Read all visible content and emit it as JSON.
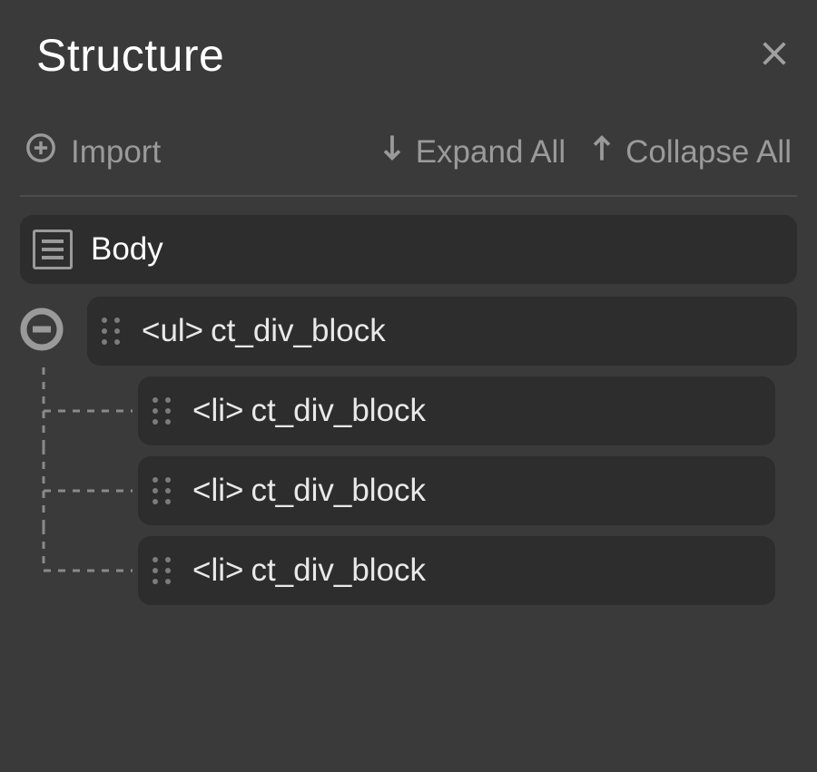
{
  "header": {
    "title": "Structure"
  },
  "toolbar": {
    "import_label": "Import",
    "expand_label": "Expand All",
    "collapse_label": "Collapse All"
  },
  "tree": {
    "body_label": "Body",
    "ul_row": {
      "tag": "<ul>",
      "name": "ct_div_block"
    },
    "children": [
      {
        "tag": "<li>",
        "name": "ct_div_block"
      },
      {
        "tag": "<li>",
        "name": "ct_div_block"
      },
      {
        "tag": "<li>",
        "name": "ct_div_block"
      }
    ]
  }
}
